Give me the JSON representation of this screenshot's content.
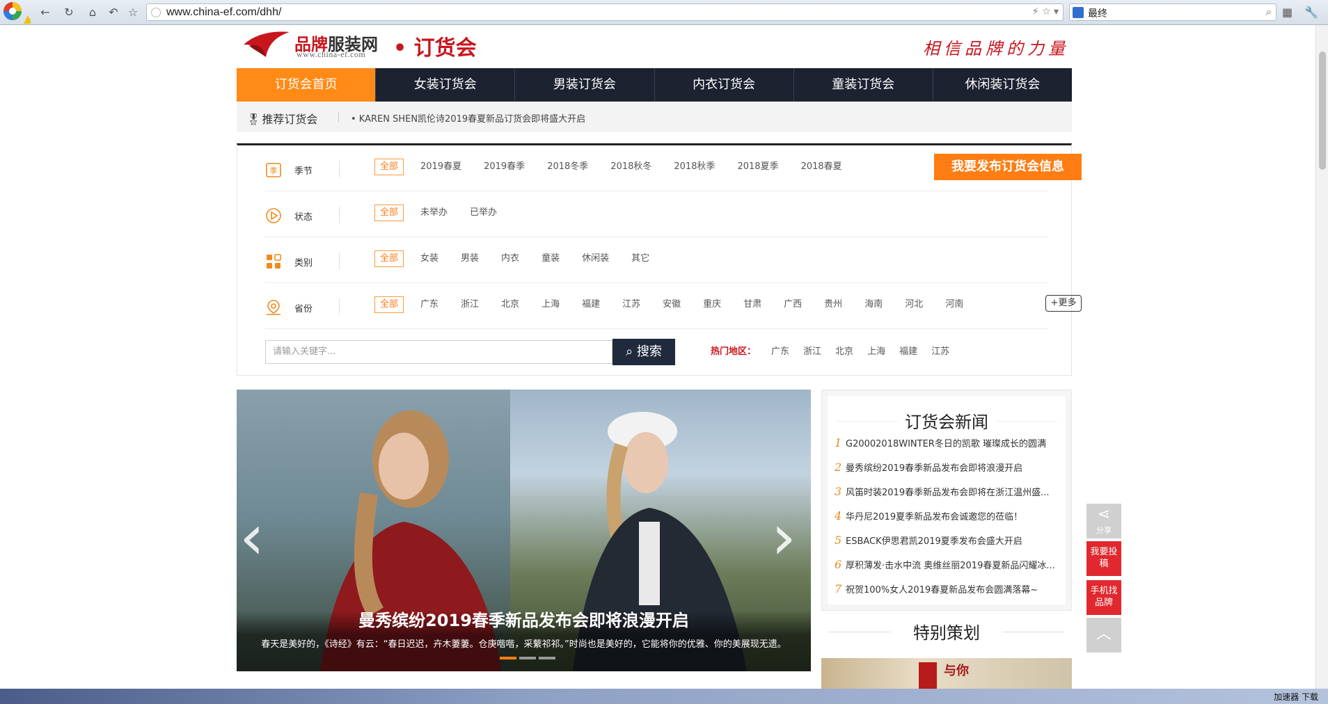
{
  "browser": {
    "url": "www.china-ef.com/dhh/",
    "search_text": "最终",
    "status_items": "加速器   下载"
  },
  "header": {
    "brand_red": "品牌",
    "brand_dark": "服装网",
    "domain": "www.china-ef.com",
    "section": "• 订货会",
    "slogan": "相信品牌的力量"
  },
  "nav": {
    "items": [
      "订货会首页",
      "女装订货会",
      "男装订货会",
      "内衣订货会",
      "童装订货会",
      "休闲装订货会"
    ],
    "active_index": 0
  },
  "recommend": {
    "label": "推荐订货会",
    "news": "•  KAREN SHEN凯伦诗2019春夏新品订货会即将盛大开启"
  },
  "filters": {
    "season": {
      "name": "季节",
      "options": [
        "全部",
        "2019春夏",
        "2019春季",
        "2018冬季",
        "2018秋冬",
        "2018秋季",
        "2018夏季",
        "2018春夏"
      ]
    },
    "status": {
      "name": "状态",
      "options": [
        "全部",
        "未举办",
        "已举办"
      ]
    },
    "category": {
      "name": "类别",
      "options": [
        "全部",
        "女装",
        "男装",
        "内衣",
        "童装",
        "休闲装",
        "其它"
      ]
    },
    "province": {
      "name": "省份",
      "options": [
        "全部",
        "广东",
        "浙江",
        "北京",
        "上海",
        "福建",
        "江苏",
        "安徽",
        "重庆",
        "甘肃",
        "广西",
        "贵州",
        "海南",
        "河北",
        "河南"
      ]
    },
    "publish_label": "我要发布订货会信息",
    "more_label": "+更多"
  },
  "search": {
    "placeholder": "请输入关键字...",
    "button": "搜索",
    "hot_label": "热门地区：",
    "hot_items": [
      "广东",
      "浙江",
      "北京",
      "上海",
      "福建",
      "江苏"
    ]
  },
  "banner": {
    "title": "曼秀缤纷2019春季新品发布会即将浪漫开启",
    "text": "春天是美好的，《诗经》有云：“春日迟迟，卉木萋萋。仓庚喈喈，采蘩祁祁。”时尚也是美好的，它能将你的优雅、你的美展现无遗。",
    "slide_index": 0,
    "slide_count": 3
  },
  "news": {
    "title": "订货会新闻",
    "items": [
      "G20002018WINTER冬日的凯歌 璀璨成长的圆满",
      "曼秀缤纷2019春季新品发布会即将浪漫开启",
      "风笛时装2019春季新品发布会即将在浙江温州盛...",
      "华丹尼2019夏季新品发布会诚邀您的莅临！",
      "ESBACK伊思君凯2019夏季发布会盛大开启",
      "厚积薄发·击水中流 奥维丝丽2019春夏新品闪耀冰...",
      "祝贺100%女人2019春夏新品发布会圆满落幕~"
    ]
  },
  "special": {
    "title": "特别策划",
    "img_text": "与你"
  },
  "side": {
    "share": "分享",
    "contribute": "我要投稿",
    "mobile": "手机找品牌"
  }
}
